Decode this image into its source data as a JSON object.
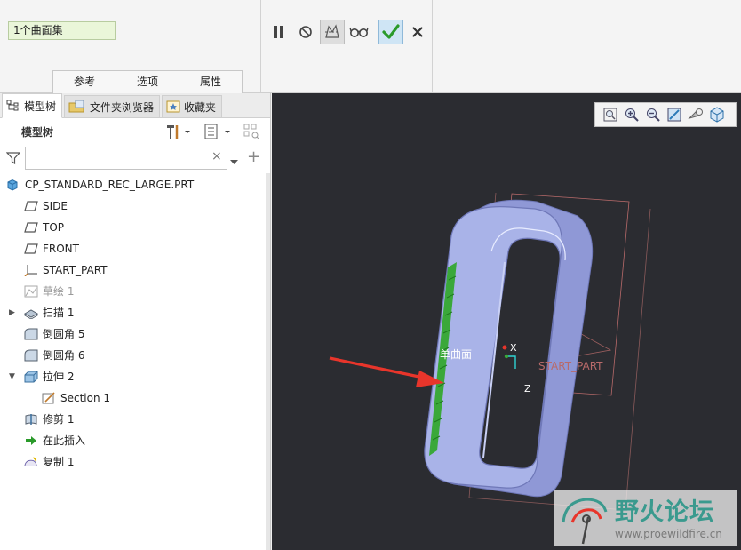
{
  "ribbon": {
    "selection_value": "1个曲面集",
    "tabs": [
      "参考",
      "选项",
      "属性"
    ]
  },
  "panel": {
    "tabs": [
      {
        "label": "模型树",
        "icon": "tree-structure-icon"
      },
      {
        "label": "文件夹浏览器",
        "icon": "folder-browser-icon"
      },
      {
        "label": "收藏夹",
        "icon": "favorites-star-icon"
      }
    ],
    "tree_title": "模型树",
    "filter_value": "",
    "clear_symbol": "×",
    "add_symbol": "+"
  },
  "tree": {
    "root": "CP_STANDARD_REC_LARGE.PRT",
    "items": [
      {
        "label": "SIDE",
        "icon": "datum-plane-icon",
        "level": 1
      },
      {
        "label": "TOP",
        "icon": "datum-plane-icon",
        "level": 1
      },
      {
        "label": "FRONT",
        "icon": "datum-plane-icon",
        "level": 1
      },
      {
        "label": "START_PART",
        "icon": "coordinate-system-icon",
        "level": 1
      },
      {
        "label": "草绘 1",
        "icon": "sketch-icon",
        "level": 1,
        "dim": true
      },
      {
        "label": "扫描 1",
        "icon": "sweep-icon",
        "level": 1,
        "expand": "collapsed"
      },
      {
        "label": "倒圆角 5",
        "icon": "round-icon",
        "level": 1
      },
      {
        "label": "倒圆角 6",
        "icon": "round-icon",
        "level": 1
      },
      {
        "label": "拉伸 2",
        "icon": "extrude-icon",
        "level": 1,
        "expand": "expanded"
      },
      {
        "label": "Section 1",
        "icon": "section-sketch-icon",
        "level": 2
      },
      {
        "label": "修剪 1",
        "icon": "trim-icon",
        "level": 1
      },
      {
        "label": "在此插入",
        "icon": "insert-here-arrow-icon",
        "level": 1
      },
      {
        "label": "复制 1",
        "icon": "copy-surface-icon",
        "level": 1
      }
    ]
  },
  "viewport": {
    "background": "#2b2c31",
    "surface_label": "单曲面",
    "csys_label": "START_PART",
    "axis_x": "X",
    "axis_z": "Z",
    "watermark_title": "野火论坛",
    "watermark_url": "www.proewildfire.cn"
  },
  "colors": {
    "model_fill": "#a9b3e8",
    "model_edge": "#6f78b8",
    "highlight": "#3aa83a",
    "arrow": "#e8352b",
    "datum": "#b86a6a",
    "check": "#2a9a2a"
  }
}
